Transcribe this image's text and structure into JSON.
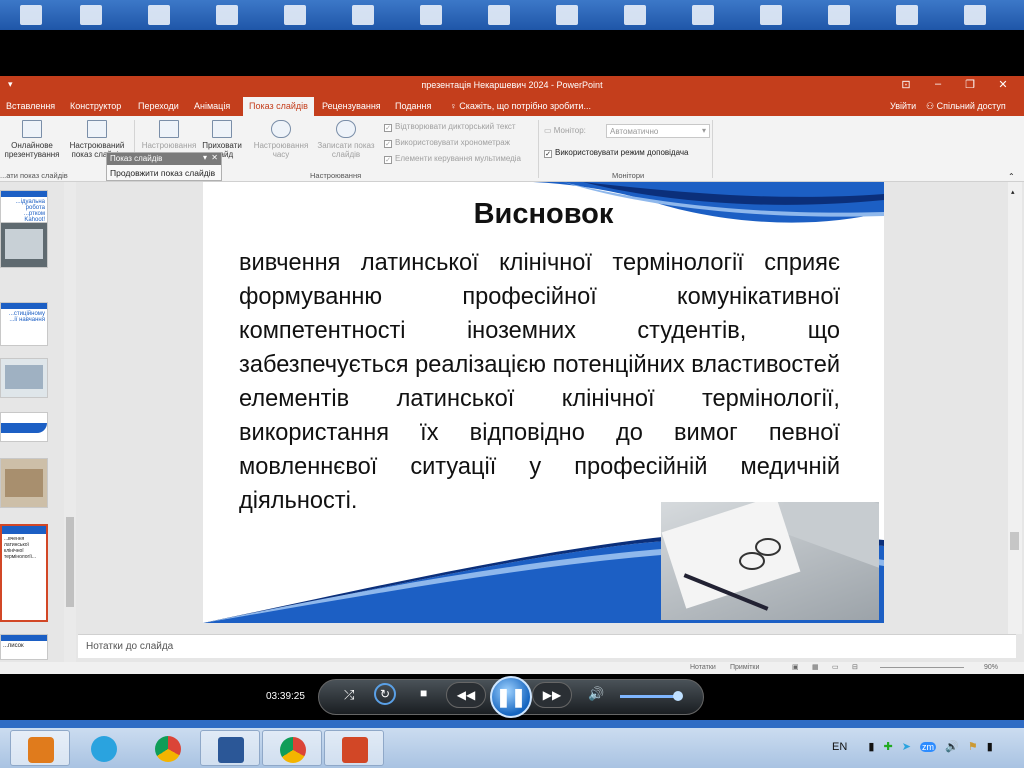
{
  "window": {
    "title": "презентація Некаршевич 2024 - PowerPoint",
    "quick_access": "▾"
  },
  "tabs": [
    {
      "label": "Вставлення"
    },
    {
      "label": "Конструктор"
    },
    {
      "label": "Переходи"
    },
    {
      "label": "Анімація"
    },
    {
      "label": "Показ слайдів",
      "active": true
    },
    {
      "label": "Рецензування"
    },
    {
      "label": "Подання"
    }
  ],
  "tell_me": "Скажіть, що потрібно зробити...",
  "signin": "Увійти",
  "share": "Спільний доступ",
  "ribbon": {
    "online_presentation": "Онлайнове презентування",
    "custom_show": "Настроюваний показ слайдів",
    "setup_show": "Настроювання показу",
    "hide_slide": "Приховати слайд",
    "rehearse": "Настроювання часу",
    "record": "Записати показ слайдів",
    "group_start": "...ати показ слайдів",
    "group_setup": "Настроювання",
    "group_monitors": "Монітори",
    "checks": [
      "Відтворювати дикторський текст",
      "Використовувати хронометраж",
      "Елементи керування мультимедіа"
    ],
    "monitor_label": "Монітор:",
    "monitor_value": "Автоматично",
    "presenter_view": "Використовувати режим доповідача"
  },
  "popup": {
    "header": "Показ слайдів",
    "item": "Продовжити показ слайдів"
  },
  "thumbnails": [
    {
      "text": "...ідуальна робота ...ртком Kahoot!"
    },
    {
      "text": ""
    },
    {
      "text": "...стиційному ...ії навчання"
    },
    {
      "text": ""
    },
    {
      "text": ""
    },
    {
      "text": ""
    },
    {
      "text": "...вчення латинської клінічної термінології..."
    },
    {
      "text": "...писок"
    }
  ],
  "slide": {
    "title": "Висновок",
    "body": "вивчення латинської клінічної термінології сприяє формуванню професійної комунікативної компетентності іноземних студентів, що забезпечується реалізацією потенційних властивостей елементів латинської клінічної термінології, використання їх відповідно до вимог певної мовленнєвої ситуації у професійній медичній діяльності."
  },
  "notes_placeholder": "Нотатки до слайда",
  "statusbar": {
    "notes": "Нотатки",
    "comments": "Примітки",
    "zoom": "90%"
  },
  "media": {
    "time": "03:39:25",
    "volume_level": 0.85
  },
  "tray": {
    "language": "EN"
  },
  "colors": {
    "ppt_accent": "#c43e1c",
    "slide_wave_blue": "#1c5fc4"
  }
}
